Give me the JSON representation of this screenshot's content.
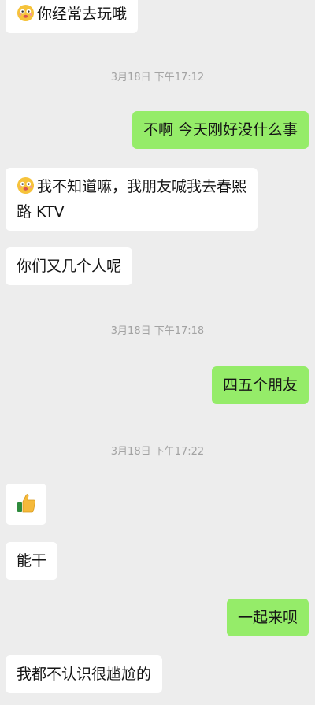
{
  "messages": [
    {
      "side": "in",
      "emoji": "dizzy-face-emoji",
      "text": "你经常去玩哦"
    },
    {
      "type": "timestamp",
      "text": "3月18日 下午17:12"
    },
    {
      "side": "out",
      "text": "不啊   今天刚好没什么事"
    },
    {
      "side": "in",
      "emoji": "dizzy-face-emoji",
      "line1": "我不知道嘛，我朋友喊我去春熙",
      "line2": "路 KTV"
    },
    {
      "side": "in",
      "text": "你们又几个人呢"
    },
    {
      "type": "timestamp",
      "text": "3月18日 下午17:18"
    },
    {
      "side": "out",
      "text": "四五个朋友"
    },
    {
      "type": "timestamp",
      "text": "3月18日 下午17:22"
    },
    {
      "side": "in",
      "emoji": "thumbs-up-emoji"
    },
    {
      "side": "in",
      "text": "能干"
    },
    {
      "side": "out",
      "text": "一起来呗"
    },
    {
      "side": "in",
      "text": "我都不认识很尴尬的"
    }
  ],
  "colors": {
    "background": "#ededed",
    "incoming_bubble": "#ffffff",
    "outgoing_bubble": "#95ec69",
    "timestamp_text": "#a3a3a3"
  }
}
